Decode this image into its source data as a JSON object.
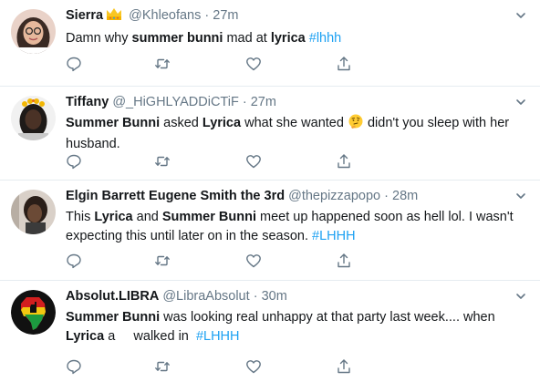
{
  "tweets": [
    {
      "name": "Sierra",
      "handle": "@Khleofans",
      "separator": "·",
      "time": "27m",
      "body": [
        {
          "t": "Damn why "
        },
        {
          "t": "summer bunni",
          "b": true
        },
        {
          "t": " mad at "
        },
        {
          "t": "lyrica",
          "b": true
        },
        {
          "t": " "
        },
        {
          "t": "#lhhh",
          "tag": true
        }
      ]
    },
    {
      "name": "Tiffany",
      "handle": "@_HiGHLYADDiCTiF",
      "separator": "·",
      "time": "27m",
      "body": [
        {
          "t": "Summer Bunni",
          "b": true
        },
        {
          "t": " asked "
        },
        {
          "t": "Lyrica",
          "b": true
        },
        {
          "t": " what she wanted "
        },
        {
          "emoji": "thinking-face"
        },
        {
          "t": " didn't you sleep with her husband."
        }
      ]
    },
    {
      "name": "Elgin Barrett Eugene Smith the 3rd",
      "handle": "@thepizzapopo",
      "separator": "·",
      "time": "28m",
      "body": [
        {
          "t": "This "
        },
        {
          "t": "Lyrica",
          "b": true
        },
        {
          "t": " and "
        },
        {
          "t": "Summer Bunni",
          "b": true
        },
        {
          "t": " meet up happened soon as hell lol. I wasn't expecting this until later on in the season. "
        },
        {
          "t": "#LHHH",
          "tag": true
        }
      ]
    },
    {
      "name": "Absolut.LIBRA",
      "handle": "@LibraAbsolut",
      "separator": "·",
      "time": "30m",
      "body": [
        {
          "t": "Summer Bunni",
          "b": true
        },
        {
          "t": " was looking real unhappy at that party last week.... when "
        },
        {
          "t": "Lyrica",
          "b": true
        },
        {
          "t": " a     walked in  "
        },
        {
          "t": "#LHHH",
          "tag": true
        }
      ]
    }
  ],
  "icons": {
    "name_badge": "crown-emoji",
    "menu": "chevron-down-icon",
    "actions": [
      "reply-icon",
      "retweet-icon",
      "like-icon",
      "share-icon"
    ]
  },
  "colors": {
    "hashtag": "#1da1f2",
    "secondary_text": "#657786",
    "divider": "#e6ecf0",
    "icon": "#657786"
  }
}
